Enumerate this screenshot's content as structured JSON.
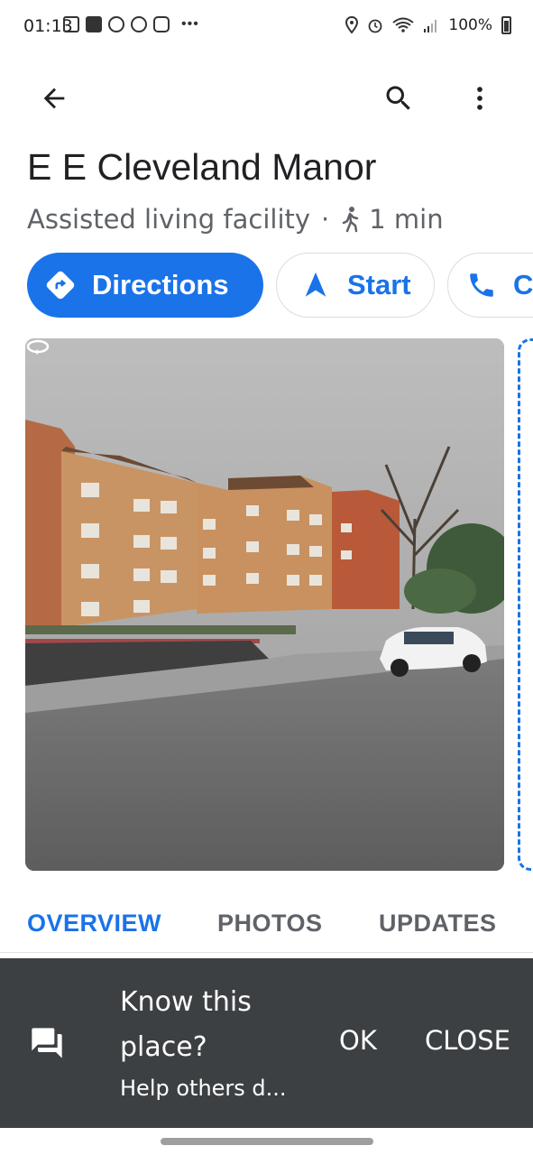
{
  "status_bar": {
    "time": "01:13",
    "battery": "100%",
    "icons": [
      "message-icon",
      "facebook-icon",
      "photos-icon",
      "face-icon",
      "instagram-icon",
      "more-dots-icon",
      "location-icon",
      "alarm-icon",
      "wifi-icon",
      "signal-icon",
      "battery-icon"
    ]
  },
  "toolbar": {
    "back_icon": "arrow-back-icon",
    "search_icon": "search-icon",
    "more_icon": "more-vert-icon"
  },
  "place": {
    "title": "E E Cleveland Manor",
    "category": "Assisted living facility",
    "separator": "·",
    "walk_time": "1 min"
  },
  "actions": {
    "directions_label": "Directions",
    "start_label": "Start",
    "call_label": "Call"
  },
  "tabs": [
    {
      "label": "OVERVIEW",
      "active": true
    },
    {
      "label": "PHOTOS",
      "active": false
    },
    {
      "label": "UPDATES",
      "active": false
    }
  ],
  "snackbar": {
    "title": "Know this place?",
    "subtitle": "Help others d...",
    "ok_label": "OK",
    "close_label": "CLOSE"
  },
  "colors": {
    "accent": "#1a73e8",
    "snackbar_bg": "#3c4043",
    "text_primary": "#202124",
    "text_secondary": "#5f6368"
  }
}
